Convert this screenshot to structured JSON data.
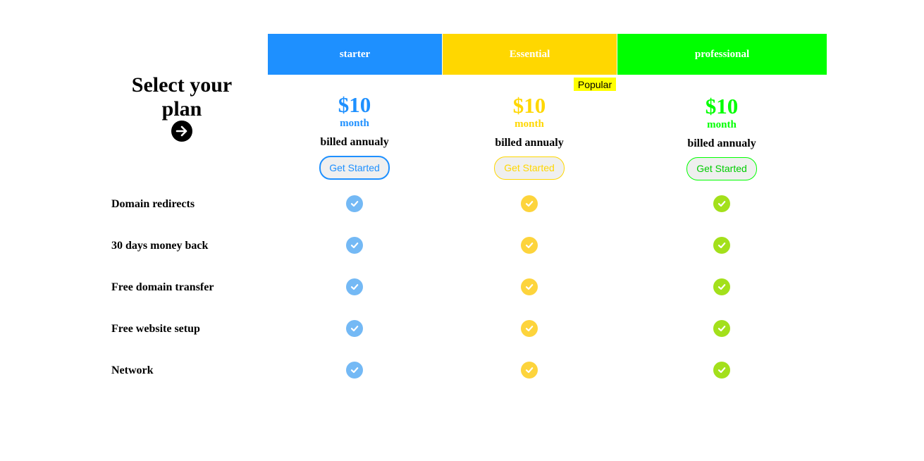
{
  "heading": {
    "title": "Select your plan"
  },
  "plans": [
    {
      "name": "starter",
      "price": "$10",
      "period": "month",
      "billing": "billed annualy",
      "cta": "Get Started",
      "header_color": "#1e90ff",
      "accent": "#1e90ff",
      "check_color": "#74b9f5"
    },
    {
      "name": "Essential",
      "price": "$10",
      "period": "month",
      "billing": "billed annualy",
      "cta": "Get Started",
      "header_color": "#ffd700",
      "accent": "#ffd700",
      "check_color": "#fdd43c",
      "badge": "Popular",
      "badge_color": "#ffff00"
    },
    {
      "name": "professional",
      "price": "$10",
      "period": "month",
      "billing": "billed annualy",
      "cta": "Get Started",
      "header_color": "#00ff00",
      "accent": "#00ff00",
      "check_color": "#a3e01b"
    }
  ],
  "features": [
    "Domain redirects",
    "30 days money back",
    "Free domain transfer",
    "Free website setup",
    "Network"
  ],
  "icons": {
    "heading_arrow": "arrow-right-icon",
    "feature_check": "check-circle-icon"
  }
}
